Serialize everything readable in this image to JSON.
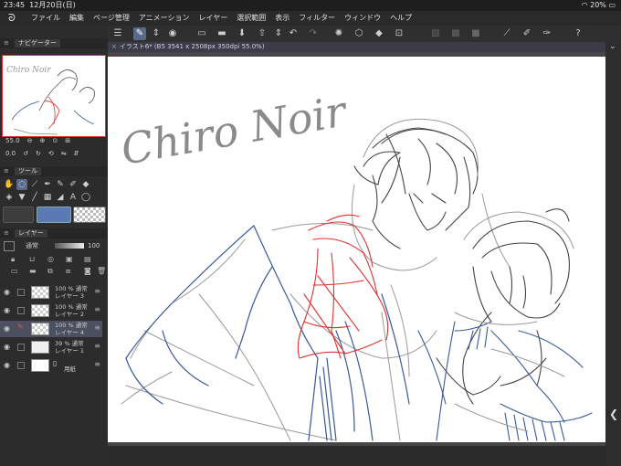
{
  "status": {
    "time": "23:45",
    "date": "12月20日(日)",
    "battery": "20%"
  },
  "menu": {
    "items": [
      "ファイル",
      "編集",
      "ページ管理",
      "アニメーション",
      "レイヤー",
      "選択範囲",
      "表示",
      "フィルター",
      "ウィンドウ",
      "ヘルプ"
    ]
  },
  "document": {
    "tab_title": "イラスト6* (B5 3541 x 2508px 350dpi 55.0%)"
  },
  "navigator": {
    "tab": "ナビゲーター",
    "zoom": "55.0",
    "rotation": "0.0"
  },
  "tool_panel": {
    "tab": "ツール"
  },
  "layer_panel": {
    "tab": "レイヤー",
    "blend": "通常",
    "opacity": "100",
    "layers": [
      {
        "line1": "100 % 通常",
        "line2": "レイヤー 3",
        "selected": false
      },
      {
        "line1": "100 % 通常",
        "line2": "レイヤー 2",
        "selected": false
      },
      {
        "line1": "100 % 通常",
        "line2": "レイヤー 4",
        "selected": true
      },
      {
        "line1": "39 % 通常",
        "line2": "レイヤー 1",
        "selected": false
      },
      {
        "line1": "",
        "line2": "用紙",
        "selected": false
      }
    ]
  },
  "canvas": {
    "handwriting": "Chiro Noir"
  },
  "colors": {
    "accent": "#5a6b8a",
    "main_color": "#5b79b3",
    "scarf": "#e03030",
    "blue_line": "#3a5a9a",
    "gray_line": "#8a8a8a"
  }
}
